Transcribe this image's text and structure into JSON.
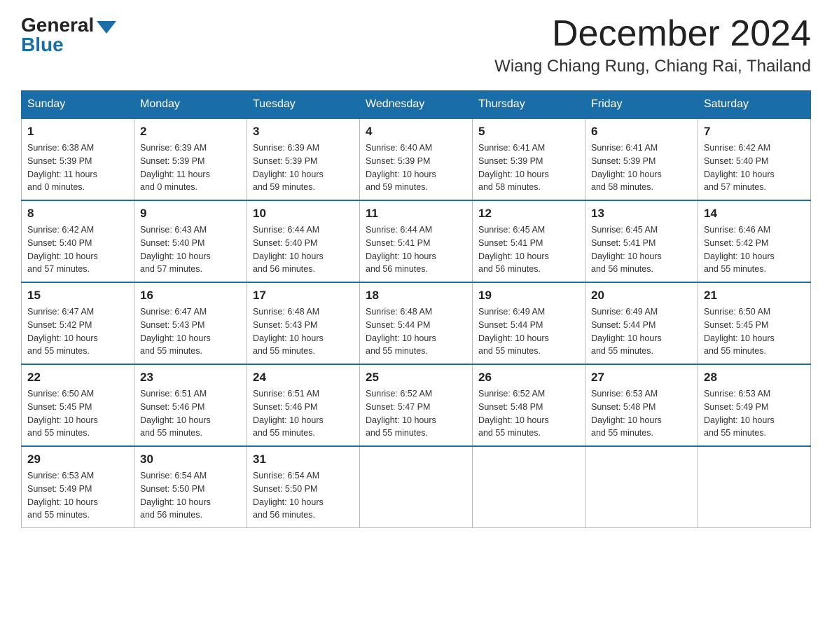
{
  "logo": {
    "general": "General",
    "blue": "Blue"
  },
  "title": "December 2024",
  "location": "Wiang Chiang Rung, Chiang Rai, Thailand",
  "days_of_week": [
    "Sunday",
    "Monday",
    "Tuesday",
    "Wednesday",
    "Thursday",
    "Friday",
    "Saturday"
  ],
  "weeks": [
    [
      {
        "day": "1",
        "sunrise": "6:38 AM",
        "sunset": "5:39 PM",
        "daylight": "11 hours and 0 minutes."
      },
      {
        "day": "2",
        "sunrise": "6:39 AM",
        "sunset": "5:39 PM",
        "daylight": "11 hours and 0 minutes."
      },
      {
        "day": "3",
        "sunrise": "6:39 AM",
        "sunset": "5:39 PM",
        "daylight": "10 hours and 59 minutes."
      },
      {
        "day": "4",
        "sunrise": "6:40 AM",
        "sunset": "5:39 PM",
        "daylight": "10 hours and 59 minutes."
      },
      {
        "day": "5",
        "sunrise": "6:41 AM",
        "sunset": "5:39 PM",
        "daylight": "10 hours and 58 minutes."
      },
      {
        "day": "6",
        "sunrise": "6:41 AM",
        "sunset": "5:39 PM",
        "daylight": "10 hours and 58 minutes."
      },
      {
        "day": "7",
        "sunrise": "6:42 AM",
        "sunset": "5:40 PM",
        "daylight": "10 hours and 57 minutes."
      }
    ],
    [
      {
        "day": "8",
        "sunrise": "6:42 AM",
        "sunset": "5:40 PM",
        "daylight": "10 hours and 57 minutes."
      },
      {
        "day": "9",
        "sunrise": "6:43 AM",
        "sunset": "5:40 PM",
        "daylight": "10 hours and 57 minutes."
      },
      {
        "day": "10",
        "sunrise": "6:44 AM",
        "sunset": "5:40 PM",
        "daylight": "10 hours and 56 minutes."
      },
      {
        "day": "11",
        "sunrise": "6:44 AM",
        "sunset": "5:41 PM",
        "daylight": "10 hours and 56 minutes."
      },
      {
        "day": "12",
        "sunrise": "6:45 AM",
        "sunset": "5:41 PM",
        "daylight": "10 hours and 56 minutes."
      },
      {
        "day": "13",
        "sunrise": "6:45 AM",
        "sunset": "5:41 PM",
        "daylight": "10 hours and 56 minutes."
      },
      {
        "day": "14",
        "sunrise": "6:46 AM",
        "sunset": "5:42 PM",
        "daylight": "10 hours and 55 minutes."
      }
    ],
    [
      {
        "day": "15",
        "sunrise": "6:47 AM",
        "sunset": "5:42 PM",
        "daylight": "10 hours and 55 minutes."
      },
      {
        "day": "16",
        "sunrise": "6:47 AM",
        "sunset": "5:43 PM",
        "daylight": "10 hours and 55 minutes."
      },
      {
        "day": "17",
        "sunrise": "6:48 AM",
        "sunset": "5:43 PM",
        "daylight": "10 hours and 55 minutes."
      },
      {
        "day": "18",
        "sunrise": "6:48 AM",
        "sunset": "5:44 PM",
        "daylight": "10 hours and 55 minutes."
      },
      {
        "day": "19",
        "sunrise": "6:49 AM",
        "sunset": "5:44 PM",
        "daylight": "10 hours and 55 minutes."
      },
      {
        "day": "20",
        "sunrise": "6:49 AM",
        "sunset": "5:44 PM",
        "daylight": "10 hours and 55 minutes."
      },
      {
        "day": "21",
        "sunrise": "6:50 AM",
        "sunset": "5:45 PM",
        "daylight": "10 hours and 55 minutes."
      }
    ],
    [
      {
        "day": "22",
        "sunrise": "6:50 AM",
        "sunset": "5:45 PM",
        "daylight": "10 hours and 55 minutes."
      },
      {
        "day": "23",
        "sunrise": "6:51 AM",
        "sunset": "5:46 PM",
        "daylight": "10 hours and 55 minutes."
      },
      {
        "day": "24",
        "sunrise": "6:51 AM",
        "sunset": "5:46 PM",
        "daylight": "10 hours and 55 minutes."
      },
      {
        "day": "25",
        "sunrise": "6:52 AM",
        "sunset": "5:47 PM",
        "daylight": "10 hours and 55 minutes."
      },
      {
        "day": "26",
        "sunrise": "6:52 AM",
        "sunset": "5:48 PM",
        "daylight": "10 hours and 55 minutes."
      },
      {
        "day": "27",
        "sunrise": "6:53 AM",
        "sunset": "5:48 PM",
        "daylight": "10 hours and 55 minutes."
      },
      {
        "day": "28",
        "sunrise": "6:53 AM",
        "sunset": "5:49 PM",
        "daylight": "10 hours and 55 minutes."
      }
    ],
    [
      {
        "day": "29",
        "sunrise": "6:53 AM",
        "sunset": "5:49 PM",
        "daylight": "10 hours and 55 minutes."
      },
      {
        "day": "30",
        "sunrise": "6:54 AM",
        "sunset": "5:50 PM",
        "daylight": "10 hours and 56 minutes."
      },
      {
        "day": "31",
        "sunrise": "6:54 AM",
        "sunset": "5:50 PM",
        "daylight": "10 hours and 56 minutes."
      },
      null,
      null,
      null,
      null
    ]
  ]
}
